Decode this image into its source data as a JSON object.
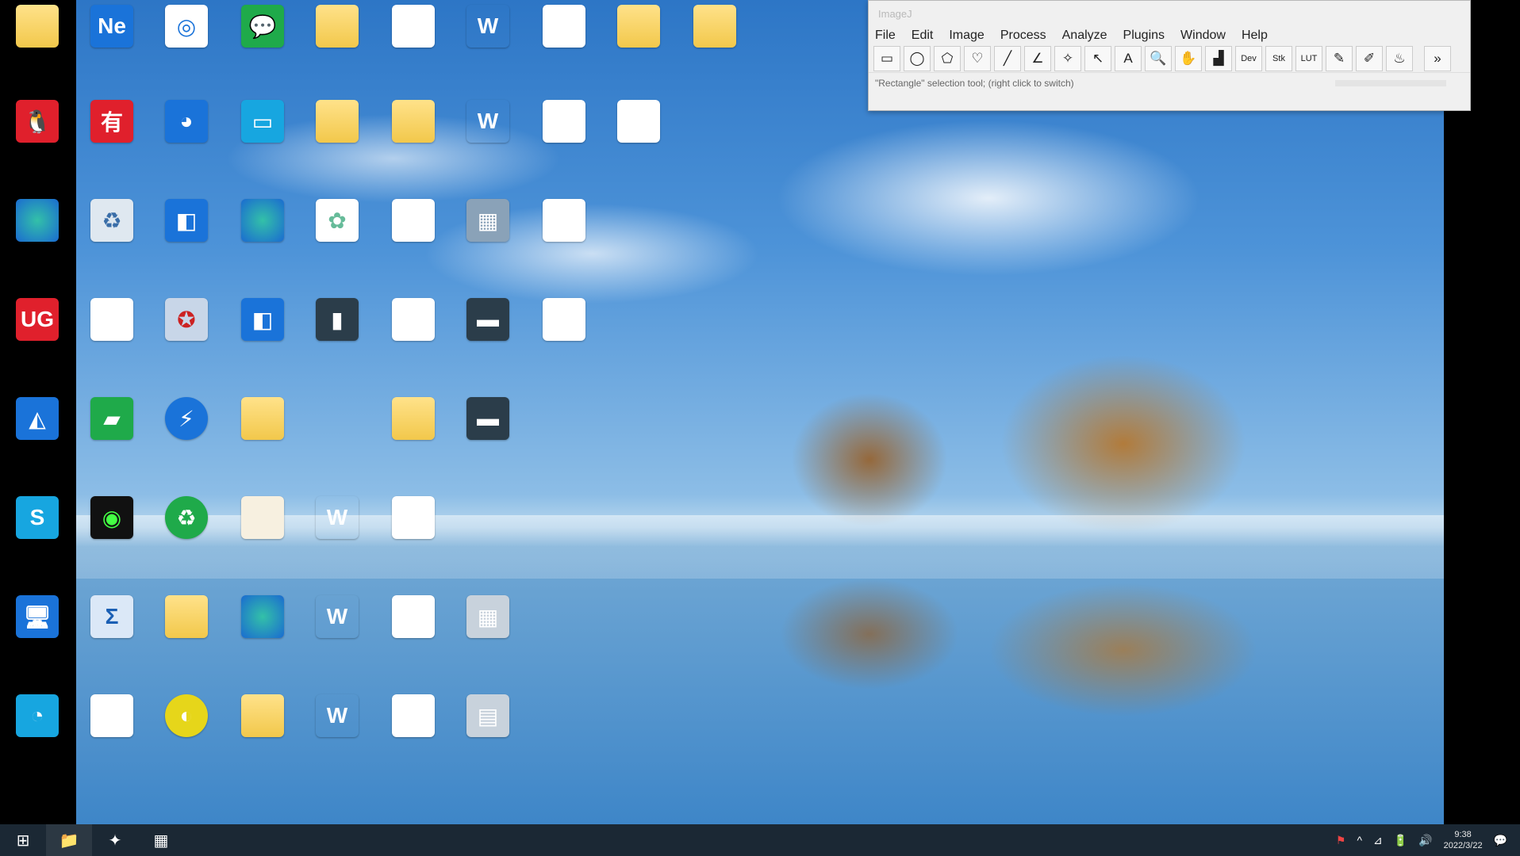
{
  "imagej": {
    "title": "ImageJ",
    "menu": [
      "File",
      "Edit",
      "Image",
      "Process",
      "Analyze",
      "Plugins",
      "Window",
      "Help"
    ],
    "tools": [
      "▭",
      "◯",
      "⬠",
      "♡",
      "╱",
      "∠",
      "✧",
      "↖",
      "A",
      "🔍",
      "✋",
      "▟",
      "Dev",
      "Stk",
      "LUT",
      "✎",
      "✐",
      "♨",
      "»"
    ],
    "status": "\"Rectangle\" selection tool; (right click to switch)"
  },
  "taskbar": {
    "start": "⊞",
    "pinned": [
      "📁",
      "✦",
      "▦"
    ],
    "tray": [
      "⚑",
      "^",
      "⊿",
      "🔋",
      "🔊",
      "💬"
    ],
    "time": "9:38",
    "date": "2022/3/22"
  }
}
